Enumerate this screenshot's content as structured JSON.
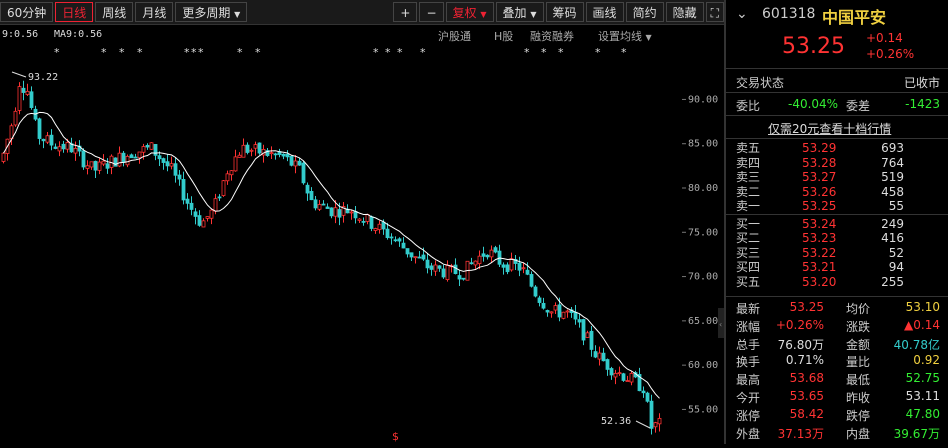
{
  "toolbar": {
    "items": [
      "60分钟",
      "日线",
      "周线",
      "月线",
      "更多周期"
    ],
    "right_items": [
      "+",
      "−",
      "复权",
      "叠加",
      "筹码",
      "画线",
      "简约",
      "隐藏"
    ]
  },
  "indicator": {
    "ma_prev": "9:0.56",
    "ma9": "MA9:0.56"
  },
  "subtabs": [
    "沪股通",
    "H股",
    "融资融券",
    "设置均线"
  ],
  "chart": {
    "yaxis": [
      "90.00",
      "85.00",
      "80.00",
      "75.00",
      "70.00",
      "65.00",
      "60.00",
      "55.00"
    ],
    "high_label": "93.22",
    "low_label": "52.36"
  },
  "stock": {
    "code": "601318",
    "name": "中国平安",
    "price": "53.25",
    "change": "+0.14",
    "change_pct": "+0.26%"
  },
  "status": {
    "label": "交易状态",
    "value": "已收市"
  },
  "weibi": {
    "label": "委比",
    "value": "-40.04%",
    "label2": "委差",
    "value2": "-1423"
  },
  "promo": "仅需20元查看十档行情",
  "sells": [
    {
      "l": "卖五",
      "p": "53.29",
      "v": "693"
    },
    {
      "l": "卖四",
      "p": "53.28",
      "v": "764"
    },
    {
      "l": "卖三",
      "p": "53.27",
      "v": "519"
    },
    {
      "l": "卖二",
      "p": "53.26",
      "v": "458"
    },
    {
      "l": "卖一",
      "p": "53.25",
      "v": "55"
    }
  ],
  "buys": [
    {
      "l": "买一",
      "p": "53.24",
      "v": "249"
    },
    {
      "l": "买二",
      "p": "53.23",
      "v": "416"
    },
    {
      "l": "买三",
      "p": "53.22",
      "v": "52"
    },
    {
      "l": "买四",
      "p": "53.21",
      "v": "94"
    },
    {
      "l": "买五",
      "p": "53.20",
      "v": "255"
    }
  ],
  "stats": [
    {
      "l1": "最新",
      "v1": "53.25",
      "c1": "r",
      "l2": "均价",
      "v2": "53.10",
      "c2": "y"
    },
    {
      "l1": "涨幅",
      "v1": "+0.26%",
      "c1": "r",
      "l2": "涨跌",
      "v2": "▲0.14",
      "c2": "r"
    },
    {
      "l1": "总手",
      "v1": "76.80万",
      "c1": "w",
      "l2": "金额",
      "v2": "40.78亿",
      "c2": "cy"
    },
    {
      "l1": "换手",
      "v1": "0.71%",
      "c1": "w",
      "l2": "量比",
      "v2": "0.92",
      "c2": "y"
    },
    {
      "l1": "最高",
      "v1": "53.68",
      "c1": "r",
      "l2": "最低",
      "v2": "52.75",
      "c2": "g"
    },
    {
      "l1": "今开",
      "v1": "53.65",
      "c1": "r",
      "l2": "昨收",
      "v2": "53.11",
      "c2": "w"
    },
    {
      "l1": "涨停",
      "v1": "58.42",
      "c1": "r",
      "l2": "跌停",
      "v2": "47.80",
      "c2": "g"
    },
    {
      "l1": "外盘",
      "v1": "37.13万",
      "c1": "r",
      "l2": "内盘",
      "v2": "39.67万",
      "c2": "g"
    }
  ],
  "colors": {
    "up": "#ff3333",
    "down": "#33cccc",
    "ma": "#ffffff"
  }
}
